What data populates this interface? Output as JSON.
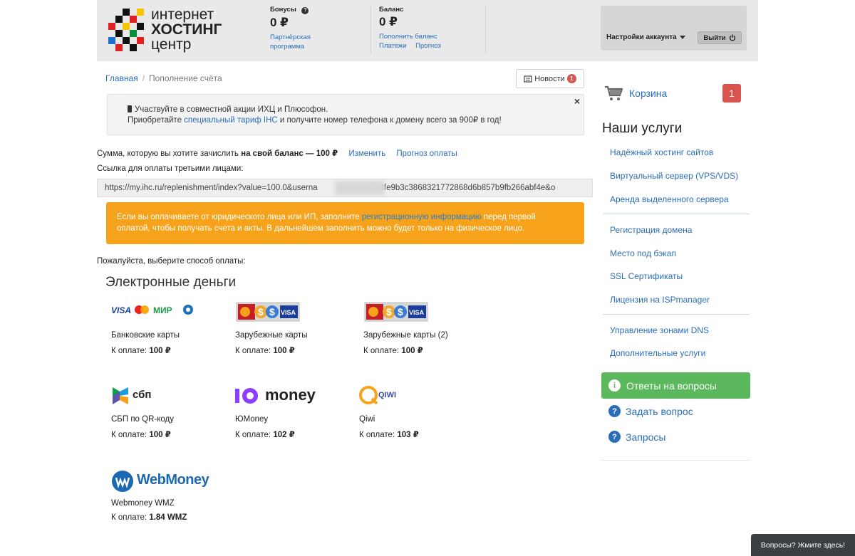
{
  "header": {
    "logo": {
      "line1": "интернет",
      "line2": "хостинг",
      "line3": "центр"
    },
    "bonus": {
      "label": "Бонусы",
      "value": "0 ₽",
      "link": "Партнёрская программа"
    },
    "balance": {
      "label": "Баланс",
      "value": "0 ₽",
      "topup_link": "Пополнить баланс",
      "payments_link": "Платежи",
      "forecast_link": "Прогноз"
    },
    "account_settings": "Настройки аккаунта",
    "logout": "Выйти"
  },
  "breadcrumb": {
    "home": "Главная",
    "current": "Пополнение счёта"
  },
  "news": {
    "label": "Новости",
    "count": "1"
  },
  "promo": {
    "line1": "Участвуйте в совместной акции ИХЦ и Плюсофон.",
    "line2_pre": "Приобретайте",
    "line2_link": "специальный тариф IHC",
    "line2_post": "и получите номер телефона к домену всего за 900₽ в год!",
    "close": "×"
  },
  "amount": {
    "text_pre": "Сумма, которую вы хотите зачислить",
    "text_bold": "на свой баланс",
    "text_post": "— 100 ₽",
    "change_link": "Изменить",
    "forecast_link": "Прогноз оплаты"
  },
  "third_party": {
    "label": "Ссылка для оплаты третьими лицами:",
    "url_start": "https://my.ihc.ru/replenishment/index?value=100.0&userna",
    "url_end": "ash=fb3fe9b3c3868321772868d6b857b9fb266abf4e&o"
  },
  "legal_alert": {
    "pre": "Если вы оплачиваете от юридического лица или ИП, заполните",
    "link": "регистрационную информацию",
    "post": "перед первой",
    "line2": "оплатой, чтобы получать счета и акты. В дальнейшем заполнить можно будет только на физическое лицо."
  },
  "choose_label": "Пожалуйста, выберите способ оплаты:",
  "section_title": "Электронные деньги",
  "payment_methods": [
    {
      "name": "Банковские карты",
      "price_label": "К оплате:",
      "price": "100 ₽",
      "logo": "visa-mastercard-mir-logo"
    },
    {
      "name": "Зарубежные карты",
      "price_label": "К оплате:",
      "price": "100 ₽",
      "logo": "foreign-cards-logo"
    },
    {
      "name": "Зарубежные карты (2)",
      "price_label": "К оплате:",
      "price": "100 ₽",
      "logo": "foreign-cards-logo"
    },
    {
      "name": "СБП по QR-коду",
      "price_label": "К оплате:",
      "price": "100 ₽",
      "logo": "sbp-logo",
      "logo_text": "сбп"
    },
    {
      "name": "ЮMoney",
      "price_label": "К оплате:",
      "price": "102 ₽",
      "logo": "yumoney-logo",
      "logo_text": "money"
    },
    {
      "name": "Qiwi",
      "price_label": "К оплате:",
      "price": "103 ₽",
      "logo": "qiwi-logo",
      "logo_text": "QIWI"
    },
    {
      "name": "Webmoney WMZ",
      "price_label": "К оплате:",
      "price": "1.84 WMZ",
      "logo": "webmoney-logo",
      "logo_text": "WebMoney"
    }
  ],
  "sidebar": {
    "cart": {
      "label": "Корзина",
      "count": "1"
    },
    "services_title": "Наши услуги",
    "services": [
      "Надёжный хостинг сайтов",
      "Виртуальный сервер (VPS/VDS)",
      "Аренда выделенного сервера",
      "Регистрация домена",
      "Место под бэкап",
      "SSL Сертификаты",
      "Лицензия на ISPmanager",
      "Управление зонами DNS",
      "Дополнительные услуги"
    ],
    "faq_button": "Ответы на вопросы",
    "ask_question": "Задать вопрос",
    "requests": "Запросы"
  },
  "chat": {
    "label": "Вопросы? Жмите здесь!"
  },
  "colors": {
    "accent_link": "#2a6ebb",
    "alert_orange": "#f7a21b",
    "badge_red": "#d9534f",
    "faq_green": "#5cb85c"
  }
}
